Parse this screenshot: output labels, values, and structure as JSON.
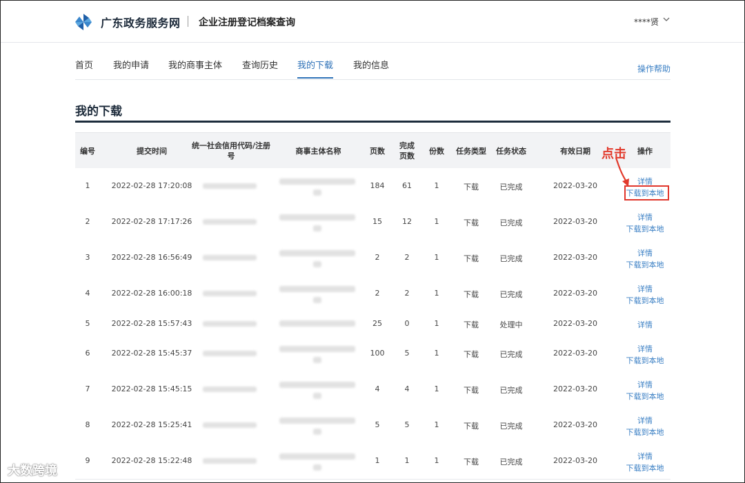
{
  "header": {
    "site_name": "广东政务服务网",
    "sub_name": "企业注册登记档案查询",
    "user": "****贤",
    "colors": {
      "brand": "#1f5fa8",
      "accent": "#2f72b8"
    }
  },
  "nav": {
    "tabs": [
      {
        "label": "首页",
        "active": false
      },
      {
        "label": "我的申请",
        "active": false
      },
      {
        "label": "我的商事主体",
        "active": false
      },
      {
        "label": "查询历史",
        "active": false
      },
      {
        "label": "我的下载",
        "active": true
      },
      {
        "label": "我的信息",
        "active": false
      }
    ],
    "help": "操作帮助"
  },
  "page": {
    "title": "我的下载"
  },
  "table": {
    "headers": {
      "no": "编号",
      "time": "提交时间",
      "code_line1": "统一社会信用代码/注册",
      "code_line2": "号",
      "name": "商事主体名称",
      "pages": "页数",
      "done_line1": "完成",
      "done_line2": "页数",
      "copies": "份数",
      "type": "任务类型",
      "status": "任务状态",
      "expiry": "有效日期",
      "ops": "操作"
    },
    "rows": [
      {
        "no": "1",
        "time": "2022-02-28 17:20:08",
        "pages": "184",
        "done": "61",
        "copies": "1",
        "type": "下载",
        "status": "已完成",
        "expiry": "2022-03-20",
        "detail": "详情",
        "download": "下载到本地"
      },
      {
        "no": "2",
        "time": "2022-02-28 17:17:26",
        "pages": "15",
        "done": "12",
        "copies": "1",
        "type": "下载",
        "status": "已完成",
        "expiry": "2022-03-20",
        "detail": "详情",
        "download": "下载到本地"
      },
      {
        "no": "3",
        "time": "2022-02-28 16:56:49",
        "pages": "2",
        "done": "2",
        "copies": "1",
        "type": "下载",
        "status": "已完成",
        "expiry": "2022-03-20",
        "detail": "详情",
        "download": "下载到本地"
      },
      {
        "no": "4",
        "time": "2022-02-28 16:00:18",
        "pages": "2",
        "done": "2",
        "copies": "1",
        "type": "下载",
        "status": "已完成",
        "expiry": "2022-03-20",
        "detail": "详情",
        "download": "下载到本地"
      },
      {
        "no": "5",
        "time": "2022-02-28 15:57:43",
        "pages": "25",
        "done": "0",
        "copies": "1",
        "type": "下载",
        "status": "处理中",
        "expiry": "2022-03-20",
        "detail": "详情",
        "download": ""
      },
      {
        "no": "6",
        "time": "2022-02-28 15:45:37",
        "pages": "100",
        "done": "5",
        "copies": "1",
        "type": "下载",
        "status": "已完成",
        "expiry": "2022-03-20",
        "detail": "详情",
        "download": "下载到本地"
      },
      {
        "no": "7",
        "time": "2022-02-28 15:45:15",
        "pages": "4",
        "done": "4",
        "copies": "1",
        "type": "下载",
        "status": "已完成",
        "expiry": "2022-03-20",
        "detail": "详情",
        "download": "下载到本地"
      },
      {
        "no": "8",
        "time": "2022-02-28 15:25:41",
        "pages": "5",
        "done": "5",
        "copies": "1",
        "type": "下载",
        "status": "已完成",
        "expiry": "2022-03-20",
        "detail": "详情",
        "download": "下载到本地"
      },
      {
        "no": "9",
        "time": "2022-02-28 15:22:48",
        "pages": "1",
        "done": "1",
        "copies": "1",
        "type": "下载",
        "status": "已完成",
        "expiry": "2022-03-20",
        "detail": "详情",
        "download": "下载到本地"
      }
    ]
  },
  "annotation": {
    "label": "点击",
    "color": "#e23a2c"
  },
  "watermark": {
    "text": "大数跨境"
  }
}
